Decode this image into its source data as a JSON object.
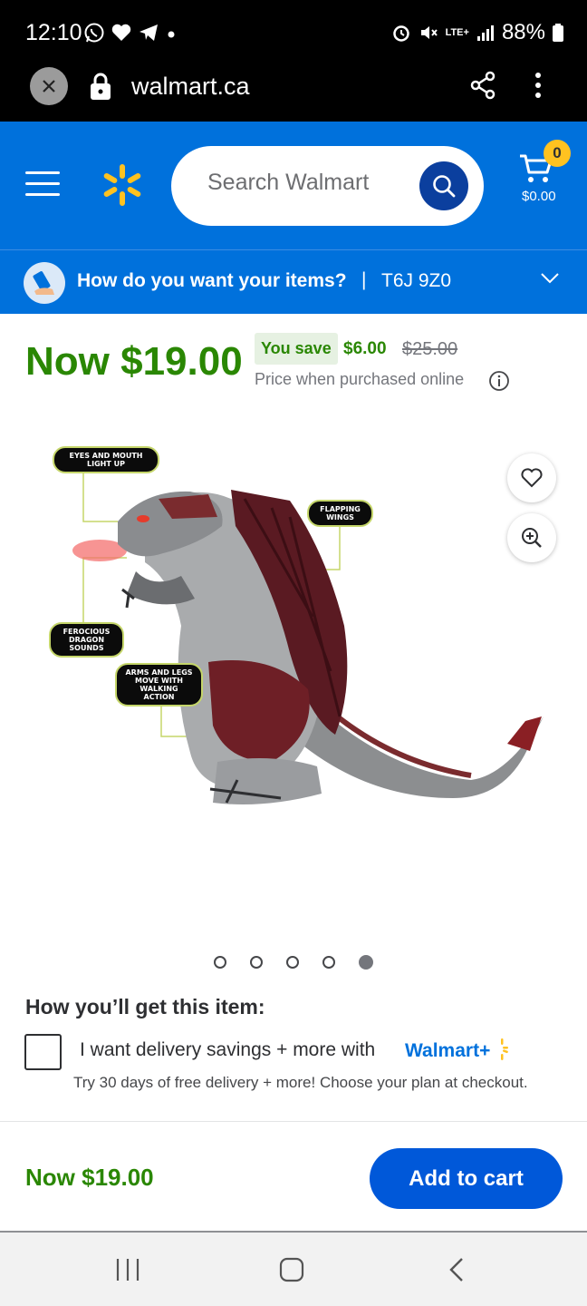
{
  "status_bar": {
    "time": "12:10",
    "network": "LTE+",
    "battery": "88%"
  },
  "browser": {
    "url": "walmart.ca",
    "icons": [
      "close-icon",
      "lock-icon",
      "share-icon",
      "more-vert-icon"
    ]
  },
  "header": {
    "search_placeholder": "Search Walmart",
    "cart_count": "0",
    "cart_total": "$0.00",
    "brand_color": "#0071dc",
    "spark_color": "#ffc220"
  },
  "location": {
    "question": "How do you want your items?",
    "separator": "|",
    "postal_code": "T6J 9Z0"
  },
  "pricing": {
    "now_price": "Now $19.00",
    "you_save_label": "You save",
    "save_amount": "$6.00",
    "was_price": "$25.00",
    "note": "Price when purchased online",
    "price_color": "#2a8703"
  },
  "product_image": {
    "callouts": {
      "eyes": "EYES AND MOUTH LIGHT UP",
      "wings": "FLAPPING WINGS",
      "sounds": "FEROCIOUS DRAGON SOUNDS",
      "arms": "ARMS AND LEGS MOVE WITH WALKING ACTION"
    },
    "carousel_total": 5,
    "carousel_active": 5
  },
  "fulfillment": {
    "heading": "How you’ll get this item:",
    "checkbox_label": "I want delivery savings + more with",
    "walmart_plus": "Walmart+",
    "subtext": "Try 30 days of free delivery + more! Choose your plan at checkout."
  },
  "footer": {
    "price": "Now $19.00",
    "add_to_cart": "Add to cart",
    "button_color": "#0058d9"
  }
}
